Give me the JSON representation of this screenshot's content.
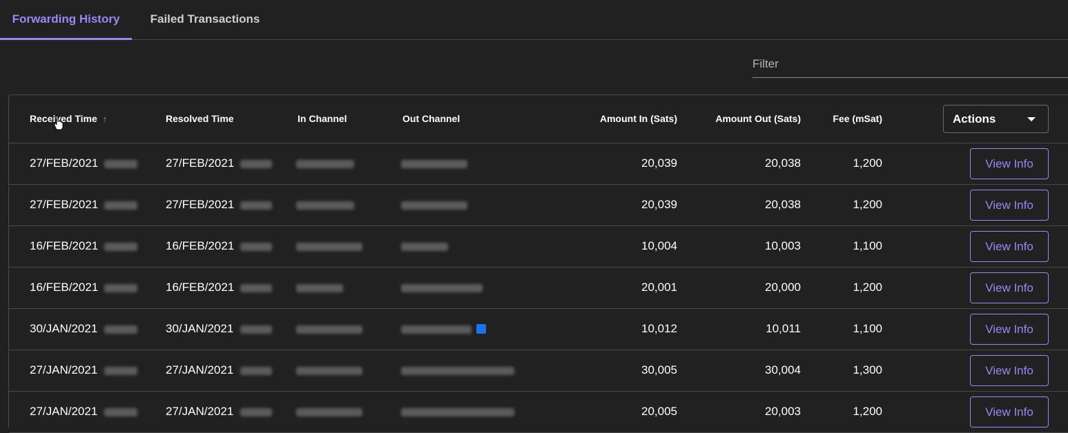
{
  "tabs": [
    {
      "label": "Forwarding History",
      "active": true
    },
    {
      "label": "Failed Transactions",
      "active": false
    }
  ],
  "filter": {
    "placeholder": "Filter",
    "value": ""
  },
  "table": {
    "columns": {
      "received_time": "Received Time",
      "resolved_time": "Resolved Time",
      "in_channel": "In Channel",
      "out_channel": "Out Channel",
      "amount_in": "Amount In (Sats)",
      "amount_out": "Amount Out (Sats)",
      "fee": "Fee (mSat)"
    },
    "sort_icon": "arrow-up-icon",
    "actions_label": "Actions",
    "view_label": "View Info",
    "rows": [
      {
        "received": "27/FEB/2021",
        "resolved": "27/FEB/2021",
        "amount_in": "20,039",
        "amount_out": "20,038",
        "fee": "1,200"
      },
      {
        "received": "27/FEB/2021",
        "resolved": "27/FEB/2021",
        "amount_in": "20,039",
        "amount_out": "20,038",
        "fee": "1,200"
      },
      {
        "received": "16/FEB/2021",
        "resolved": "16/FEB/2021",
        "amount_in": "10,004",
        "amount_out": "10,003",
        "fee": "1,100"
      },
      {
        "received": "16/FEB/2021",
        "resolved": "16/FEB/2021",
        "amount_in": "20,001",
        "amount_out": "20,000",
        "fee": "1,200"
      },
      {
        "received": "30/JAN/2021",
        "resolved": "30/JAN/2021",
        "amount_in": "10,012",
        "amount_out": "10,011",
        "fee": "1,100"
      },
      {
        "received": "27/JAN/2021",
        "resolved": "27/JAN/2021",
        "amount_in": "30,005",
        "amount_out": "30,004",
        "fee": "1,300"
      },
      {
        "received": "27/JAN/2021",
        "resolved": "27/JAN/2021",
        "amount_in": "20,005",
        "amount_out": "20,003",
        "fee": "1,200"
      }
    ]
  },
  "colors": {
    "accent": "#9b87f5",
    "background": "#212121",
    "border": "#4a4a4a"
  }
}
